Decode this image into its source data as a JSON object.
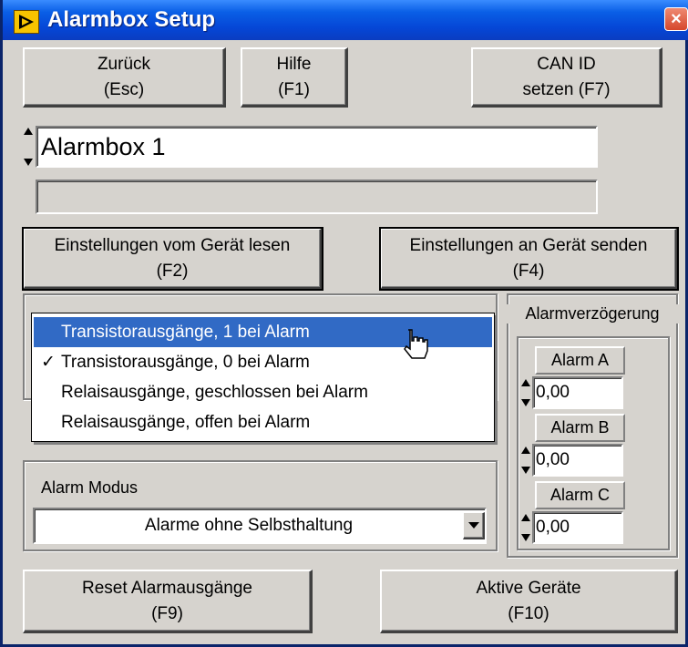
{
  "window": {
    "title": "Alarmbox Setup",
    "close_glyph": "×"
  },
  "toolbar": {
    "back_l1": "Zurück",
    "back_l2": "(Esc)",
    "help_l1": "Hilfe",
    "help_l2": "(F1)",
    "canid_l1": "CAN ID",
    "canid_l2": "setzen (F7)"
  },
  "device": {
    "name": "Alarmbox 1",
    "status": ""
  },
  "settings": {
    "read_l1": "Einstellungen vom Gerät lesen",
    "read_l2": "(F2)",
    "send_l1": "Einstellungen an Gerät senden",
    "send_l2": "(F4)"
  },
  "output_menu": {
    "items": [
      {
        "label": "Transistorausgänge, 1 bei Alarm",
        "highlighted": true,
        "checked": false
      },
      {
        "label": "Transistorausgänge, 0 bei Alarm",
        "highlighted": false,
        "checked": true
      },
      {
        "label": "Relaisausgänge, geschlossen bei Alarm",
        "highlighted": false,
        "checked": false
      },
      {
        "label": "Relaisausgänge, offen bei Alarm",
        "highlighted": false,
        "checked": false
      }
    ],
    "check_glyph": "✓"
  },
  "alarm_mode": {
    "label": "Alarm Modus",
    "value": "Alarme ohne Selbsthaltung"
  },
  "delay": {
    "title": "Alarmverzögerung",
    "alarms": [
      {
        "label": "Alarm A",
        "value": "0,00"
      },
      {
        "label": "Alarm B",
        "value": "0,00"
      },
      {
        "label": "Alarm C",
        "value": "0,00"
      }
    ]
  },
  "bottom": {
    "reset_l1": "Reset Alarmausgänge",
    "reset_l2": "(F9)",
    "active_l1": "Aktive Geräte",
    "active_l2": "(F10)"
  },
  "icons": [
    "app-icon",
    "close-icon",
    "spin-icon",
    "dropdown-arrow-icon",
    "hand-cursor-icon",
    "checkmark-icon"
  ],
  "colors": {
    "title_bar": "#0a5fe6",
    "highlight": "#316ac5",
    "window_bg": "#d6d3ce",
    "close": "#d5472c"
  }
}
